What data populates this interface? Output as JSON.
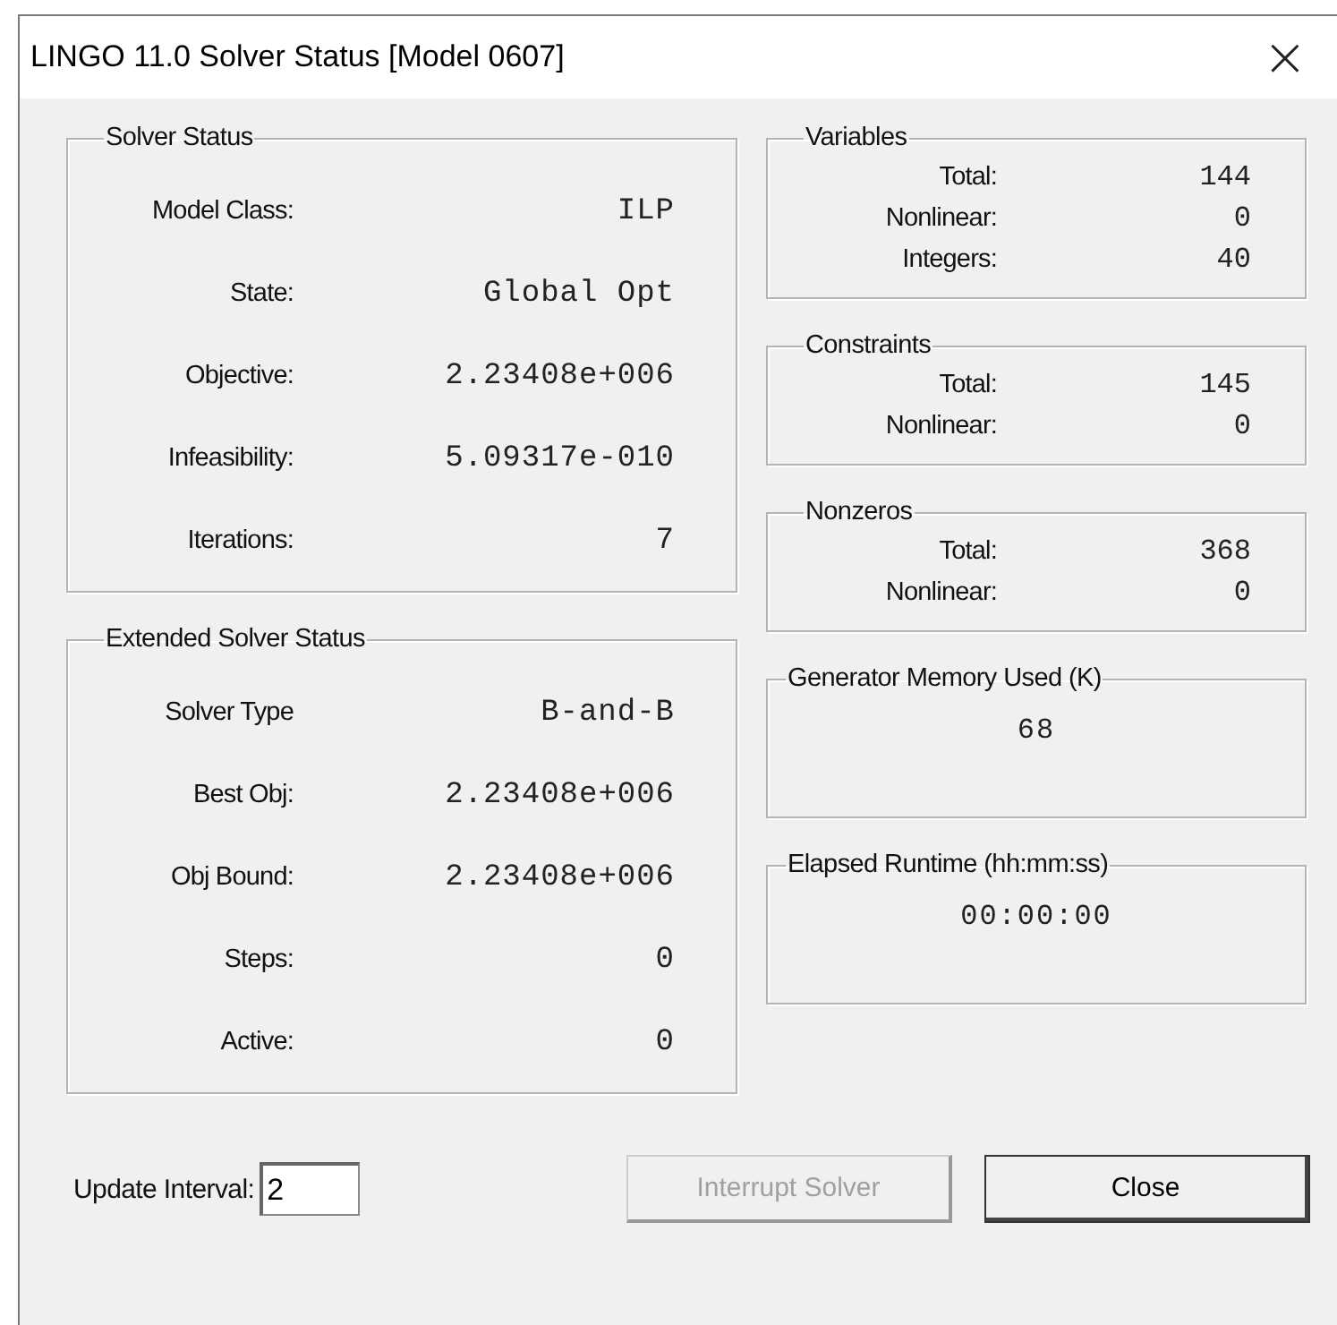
{
  "window": {
    "title": "LINGO 11.0 Solver Status [Model 0607]",
    "close": "×"
  },
  "left_groups": [
    {
      "title": "Solver Status",
      "rows": [
        {
          "label": "Model Class:",
          "value": "ILP"
        },
        {
          "label": "State:",
          "value": "Global Opt"
        },
        {
          "label": "Objective:",
          "value": "2.23408e+006"
        },
        {
          "label": "Infeasibility:",
          "value": "5.09317e-010"
        },
        {
          "label": "Iterations:",
          "value": "7"
        }
      ]
    },
    {
      "title": "Extended Solver Status",
      "rows": [
        {
          "label": "Solver Type",
          "value": "B-and-B"
        },
        {
          "label": "Best Obj:",
          "value": "2.23408e+006"
        },
        {
          "label": "Obj Bound:",
          "value": "2.23408e+006"
        },
        {
          "label": "Steps:",
          "value": "0"
        },
        {
          "label": "Active:",
          "value": "0"
        }
      ]
    }
  ],
  "right_groups": [
    {
      "kind": "table",
      "title": "Variables",
      "rows": [
        {
          "label": "Total:",
          "value": "144"
        },
        {
          "label": "Nonlinear:",
          "value": "0"
        },
        {
          "label": "Integers:",
          "value": "40"
        }
      ]
    },
    {
      "kind": "table",
      "title": "Constraints",
      "rows": [
        {
          "label": "Total:",
          "value": "145"
        },
        {
          "label": "Nonlinear:",
          "value": "0"
        }
      ]
    },
    {
      "kind": "table",
      "title": "Nonzeros",
      "rows": [
        {
          "label": "Total:",
          "value": "368"
        },
        {
          "label": "Nonlinear:",
          "value": "0"
        }
      ]
    },
    {
      "kind": "single",
      "title": "Generator Memory Used (K)",
      "value": "68"
    },
    {
      "kind": "single",
      "title": "Elapsed Runtime (hh:mm:ss)",
      "value": "00:00:00"
    }
  ],
  "update_interval": {
    "label": "Update Interval:",
    "value": "2"
  },
  "buttons": [
    {
      "label": "Interrupt Solver",
      "disabled": true,
      "default": false
    },
    {
      "label": "Close",
      "disabled": false,
      "default": true
    }
  ]
}
